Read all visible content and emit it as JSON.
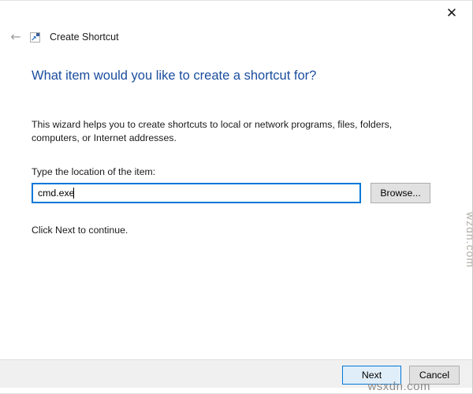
{
  "window": {
    "title": "Create Shortcut"
  },
  "icons": {
    "close": "✕",
    "back": "←",
    "shortcut_arrow": "↗"
  },
  "wizard": {
    "heading": "What item would you like to create a shortcut for?",
    "description": "This wizard helps you to create shortcuts to local or network programs, files, folders, computers, or Internet addresses.",
    "location_label": "Type the location of the item:",
    "location_value": "cmd.exe",
    "browse_label": "Browse...",
    "hint": "Click Next to continue."
  },
  "footer": {
    "next_label": "Next",
    "cancel_label": "Cancel"
  },
  "watermarks": {
    "bottom": "wsxdn.com",
    "side": "wzdn.com"
  },
  "colors": {
    "heading_blue": "#1a4d9e",
    "accent_blue": "#0078d7",
    "button_gray": "#e1e1e1",
    "button_border": "#adadad",
    "footer_bg": "#f0f0f0",
    "watermark_gray": "#8c8c8c"
  }
}
